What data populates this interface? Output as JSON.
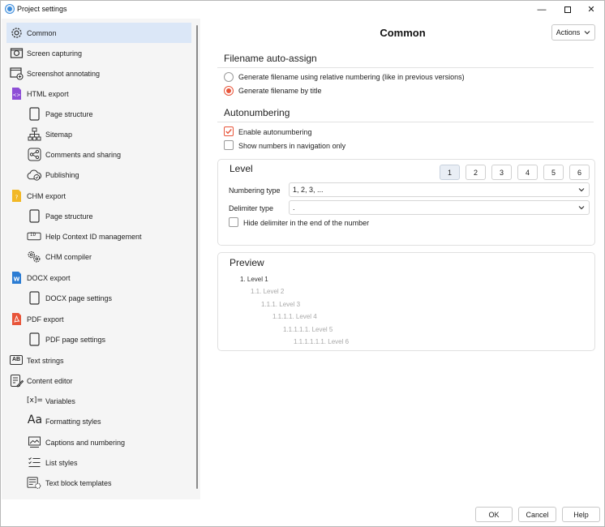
{
  "window": {
    "title": "Project settings",
    "minimize": "—",
    "close": "✕"
  },
  "sidebar": {
    "items": [
      {
        "label": "Common",
        "icon": "gear-icon",
        "selected": true
      },
      {
        "label": "Screen capturing",
        "icon": "camera-icon"
      },
      {
        "label": "Screenshot annotating",
        "icon": "screenshot-annotate-icon"
      },
      {
        "label": "HTML export",
        "icon": "html-file-icon"
      },
      {
        "label": "Page structure",
        "icon": "page-icon"
      },
      {
        "label": "Sitemap",
        "icon": "sitemap-icon"
      },
      {
        "label": "Comments and sharing",
        "icon": "share-icon"
      },
      {
        "label": "Publishing",
        "icon": "cloud-publish-icon"
      },
      {
        "label": "CHM export",
        "icon": "chm-file-icon"
      },
      {
        "label": "Page structure",
        "icon": "page-icon"
      },
      {
        "label": "Help Context ID management",
        "icon": "context-id-icon"
      },
      {
        "label": "CHM compiler",
        "icon": "gears-icon"
      },
      {
        "label": "DOCX export",
        "icon": "docx-file-icon"
      },
      {
        "label": "DOCX page settings",
        "icon": "page-icon"
      },
      {
        "label": "PDF export",
        "icon": "pdf-file-icon"
      },
      {
        "label": "PDF page settings",
        "icon": "page-icon"
      },
      {
        "label": "Text strings",
        "icon": "text-strings-icon"
      },
      {
        "label": "Content editor",
        "icon": "content-editor-icon"
      },
      {
        "label": "Variables",
        "icon": "variables-icon"
      },
      {
        "label": "Formatting styles",
        "icon": "formatting-styles-icon"
      },
      {
        "label": "Captions and numbering",
        "icon": "captions-icon"
      },
      {
        "label": "List styles",
        "icon": "list-styles-icon"
      },
      {
        "label": "Text block templates",
        "icon": "text-block-templates-icon"
      }
    ],
    "icon_glyphs": {
      "text-strings": "AB",
      "variables": "[x]=",
      "formatting-styles": "Aa",
      "context-id": "ID"
    }
  },
  "main": {
    "title": "Common",
    "actions_label": "Actions",
    "filename": {
      "heading": "Filename auto-assign",
      "options": [
        {
          "label": "Generate filename using relative numbering (like in previous versions)",
          "checked": false
        },
        {
          "label": "Generate filename by title",
          "checked": true
        }
      ]
    },
    "autonumbering": {
      "heading": "Autonumbering",
      "options": [
        {
          "label": "Enable autonumbering",
          "checked": true
        },
        {
          "label": "Show numbers in navigation only",
          "checked": false
        }
      ]
    },
    "level": {
      "heading": "Level",
      "buttons": [
        "1",
        "2",
        "3",
        "4",
        "5",
        "6"
      ],
      "active": "1",
      "numbering_type_label": "Numbering type",
      "numbering_type_value": "1, 2, 3, ...",
      "delimiter_type_label": "Delimiter type",
      "delimiter_type_value": ".",
      "hide_delimiter_label": "Hide delimiter in the end of the number",
      "hide_delimiter_checked": false
    },
    "preview": {
      "heading": "Preview",
      "lines": [
        "1. Level 1",
        "1.1. Level 2",
        "1.1.1. Level 3",
        "1.1.1.1. Level 4",
        "1.1.1.1.1. Level 5",
        "1.1.1.1.1.1. Level 6"
      ]
    }
  },
  "footer": {
    "ok": "OK",
    "cancel": "Cancel",
    "help": "Help"
  },
  "colors": {
    "accent": "#e8553a",
    "selection": "#dbe7f7",
    "html": "#8e4fd6",
    "chm": "#f2b826",
    "docx": "#2b7cd3",
    "pdf": "#e8553a"
  }
}
